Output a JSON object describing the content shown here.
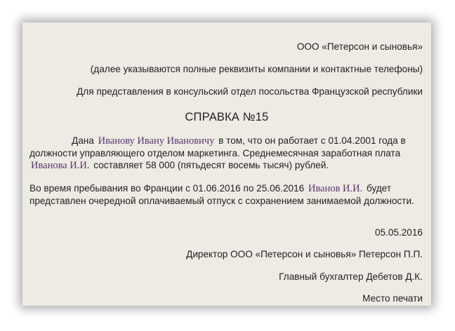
{
  "header": {
    "company": "ООО «Петерсон и сыновья»",
    "details_note": "(далее указываются полные реквизиты компании и контактные телефоны)",
    "recipient": "Для представления в консульский отдел посольства Французской республики"
  },
  "title": "СПРАВКА №15",
  "body": {
    "p1_a": "Дана",
    "p1_name": "Иванову Ивану Ивановичу",
    "p1_b": "в том, что он работает с 01.04.2001 года в должности управляющего отделом маркетинга. Среднемесячная заработная плата",
    "p1_short_name": "Иванова И.И.",
    "p1_c": "составляет 58 000 (пятьдесят восемь тысяч) рублей.",
    "p2_a": "Во время пребывания во Франции с 01.06.2016 по 25.06.2016",
    "p2_name": "Иванов И.И.",
    "p2_b": "будет представлен очередной оплачиваемый отпуск с сохранением занимаемой должности."
  },
  "footer": {
    "date": "05.05.2016",
    "director": "Директор ООО «Петерсон и сыновья» Петерсон П.П.",
    "accountant": "Главный бухгалтер Дебетов Д.К.",
    "stamp": "Место печати"
  }
}
